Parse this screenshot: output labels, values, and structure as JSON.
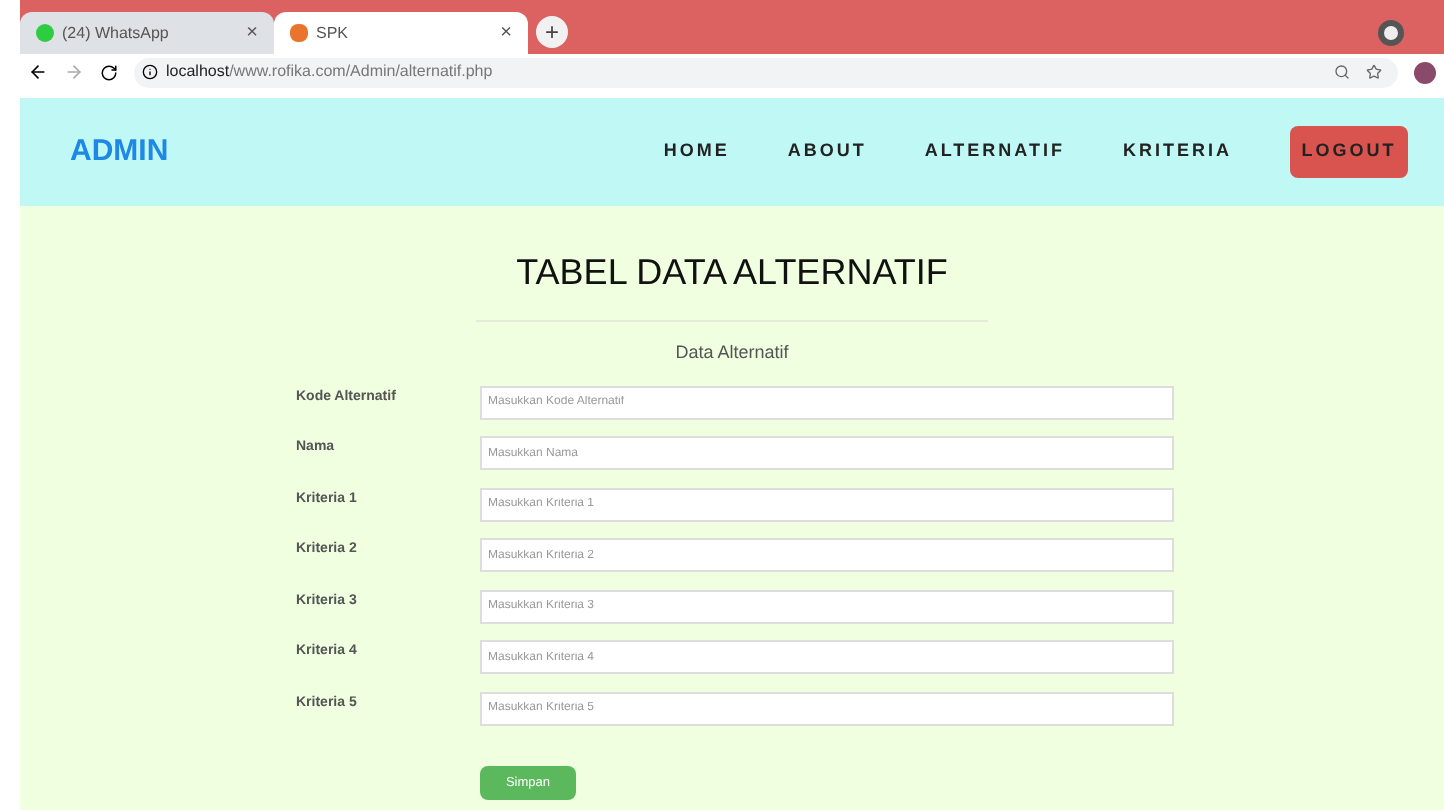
{
  "browser": {
    "tabs": [
      {
        "title": "(24) WhatsApp",
        "close": "×",
        "selected": false
      },
      {
        "title": "SPK",
        "close": "×",
        "selected": true
      }
    ],
    "new_tab": "+",
    "url_host": "localhost",
    "url_path": "/www.rofika.com/Admin/alternatif.php"
  },
  "navbar": {
    "brand": "ADMIN",
    "items": [
      "HOME",
      "ABOUT",
      "ALTERNATIF",
      "KRITERIA"
    ],
    "logout": "LOGOUT"
  },
  "page": {
    "title": "TABEL DATA ALTERNATIF",
    "subtitle": "Data Alternatif",
    "fields": [
      {
        "label": "Kode Alternatif",
        "placeholder": "Masukkan Kode Alternatif"
      },
      {
        "label": "Nama",
        "placeholder": "Masukkan Nama"
      },
      {
        "label": "Kriteria 1",
        "placeholder": "Masukkan Kriteria 1"
      },
      {
        "label": "Kriteria 2",
        "placeholder": "Masukkan Kriteria 2"
      },
      {
        "label": "Kriteria 3",
        "placeholder": "Masukkan Kriteria 3"
      },
      {
        "label": "Kriteria 4",
        "placeholder": "Masukkan Kriteria 4"
      },
      {
        "label": "Kriteria 5",
        "placeholder": "Masukkan Kriteria 5"
      }
    ],
    "submit": "Simpan"
  }
}
